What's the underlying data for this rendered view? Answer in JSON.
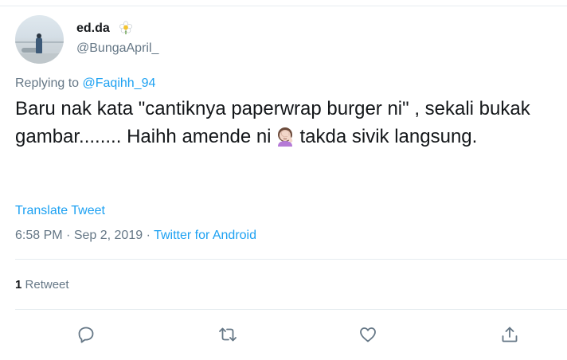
{
  "author": {
    "display_name": "ed.da",
    "handle": "@BungaApril_",
    "name_emoji_icon": "blossom-icon"
  },
  "reply": {
    "prefix": "Replying to",
    "target": "@Faqihh_94"
  },
  "tweet": {
    "text_part1": "Baru nak kata \"cantiknya paperwrap burger ni\" , sekali bukak gambar........ Haihh amende ni",
    "emoji_icon": "woman-facepalming-icon",
    "text_part2": "takda sivik langsung."
  },
  "translate_label": "Translate Tweet",
  "meta": {
    "time": "6:58 PM",
    "sep1": "·",
    "date": "Sep 2, 2019",
    "sep2": "·",
    "source": "Twitter for Android"
  },
  "stats": {
    "retweet_count": "1",
    "retweet_label": "Retweet"
  },
  "actions": [
    {
      "name": "reply",
      "icon": "comment-icon"
    },
    {
      "name": "retweet",
      "icon": "retweet-icon"
    },
    {
      "name": "like",
      "icon": "heart-icon"
    },
    {
      "name": "share",
      "icon": "share-icon"
    }
  ],
  "colors": {
    "link": "#1da1f2",
    "secondary_text": "#657786",
    "primary_text": "#14171a",
    "divider": "#e6ecf0"
  }
}
